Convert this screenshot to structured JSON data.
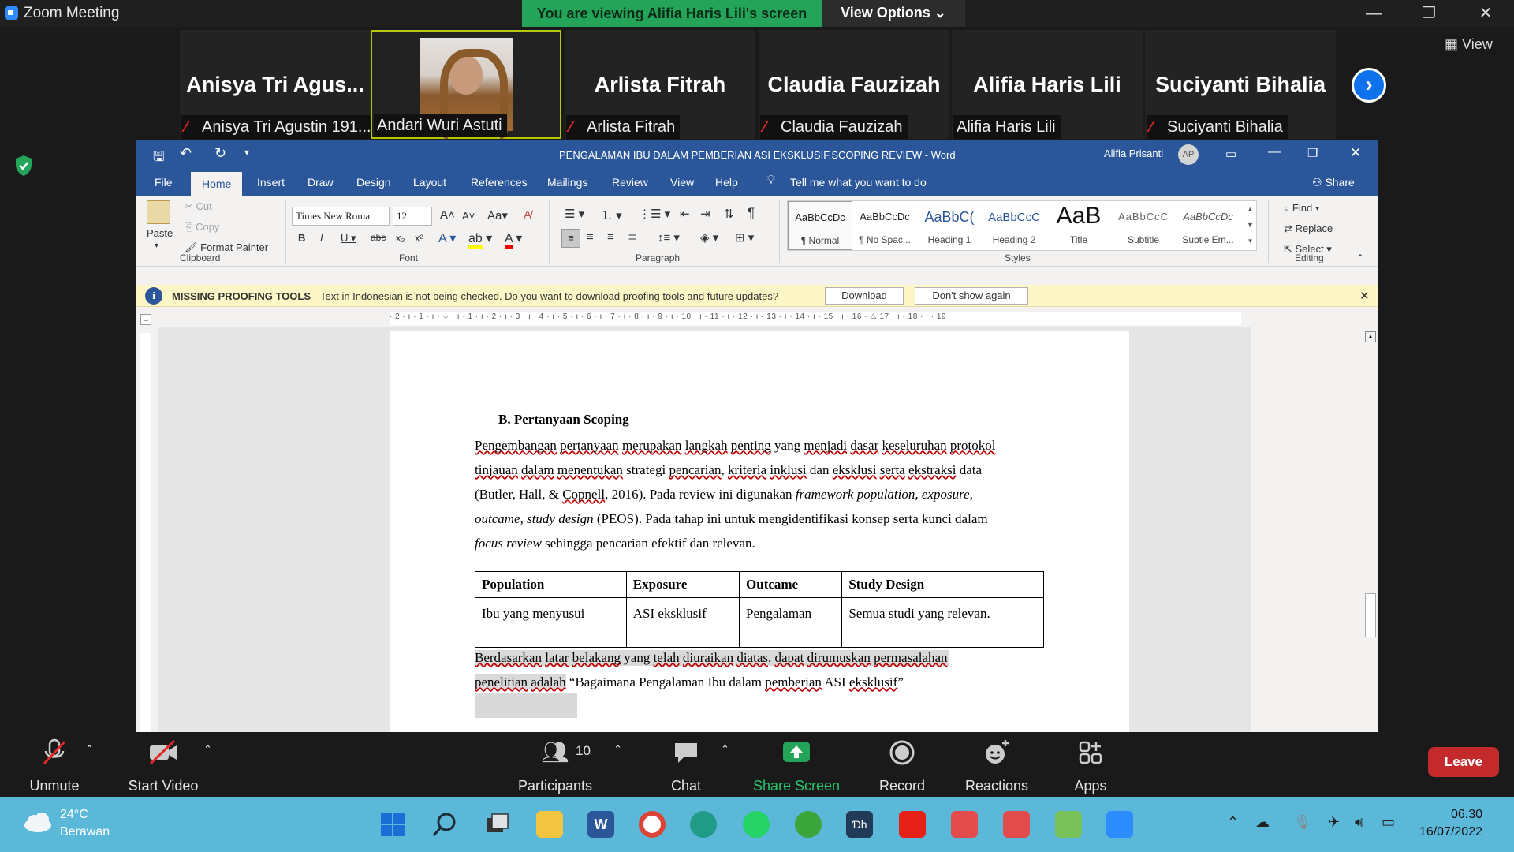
{
  "zoom": {
    "window_title": "Zoom Meeting",
    "banner": "You are viewing Alifia Haris Lili's screen",
    "view_options": "View Options ⌄",
    "view_label": "View"
  },
  "participants": [
    {
      "display_name": "Anisya Tri Agus...",
      "label": "Anisya Tri Agustin 191...",
      "muted": true
    },
    {
      "display_name": "",
      "label": "Andari Wuri Astuti",
      "muted": false
    },
    {
      "display_name": "Arlista Fitrah",
      "label": "Arlista Fitrah",
      "muted": true
    },
    {
      "display_name": "Claudia Fauzizah",
      "label": "Claudia Fauzizah",
      "muted": true
    },
    {
      "display_name": "Alifia Haris Lili",
      "label": "Alifia Haris Lili",
      "muted": false
    },
    {
      "display_name": "Suciyanti Bihalia",
      "label": "Suciyanti Bihalia",
      "muted": true
    }
  ],
  "word": {
    "doc_title": "PENGALAMAN IBU DALAM PEMBERIAN ASI EKSKLUSIF.SCOPING REVIEW  -  Word",
    "user_name": "Alifia Prisanti",
    "user_initials": "AP",
    "tabs": [
      "File",
      "Home",
      "Insert",
      "Draw",
      "Design",
      "Layout",
      "References",
      "Mailings",
      "Review",
      "View",
      "Help"
    ],
    "tell_me": "Tell me what you want to do",
    "share": "Share",
    "clipboard": {
      "paste": "Paste",
      "cut": "Cut",
      "copy": "Copy",
      "format_painter": "Format Painter",
      "label": "Clipboard"
    },
    "font": {
      "name": "Times New Roma",
      "size": "12",
      "label": "Font"
    },
    "paragraph_label": "Paragraph",
    "styles": [
      {
        "preview": "AaBbCcDc",
        "name": "¶ Normal"
      },
      {
        "preview": "AaBbCcDc",
        "name": "¶ No Spac..."
      },
      {
        "preview": "AaBbC(",
        "name": "Heading 1"
      },
      {
        "preview": "AaBbCcC",
        "name": "Heading 2"
      },
      {
        "preview": "AaB",
        "name": "Title"
      },
      {
        "preview": "AaBbCcC",
        "name": "Subtitle"
      },
      {
        "preview": "AaBbCcDc",
        "name": "Subtle Em..."
      }
    ],
    "styles_label": "Styles",
    "editing": {
      "find": "Find",
      "replace": "Replace",
      "select": "Select",
      "label": "Editing"
    },
    "message_bar": {
      "title": "MISSING PROOFING TOOLS",
      "text": "Text in Indonesian is not being checked. Do you want to download proofing tools and future updates?",
      "download": "Download",
      "dont_show": "Don't show again"
    },
    "ruler_text": "· 2 · ı · 1 · ı · ⌵ · ı · 1 · ı · 2 · ı · 3 · ı · 4 · ı · 5 · ı · 6 · ı · 7 · ı · 8 · ı · 9 · ı · 10 · ı · 11 · ı · 12 · ı · 13 · ı · 14 · ı · 15 · ı · 16 · △ 17 · ı · 18 · ı · 19",
    "document": {
      "heading": "B.  Pertanyaan Scoping",
      "para_lines": [
        "Pengembangan pertanyaan merupakan langkah penting yang menjadi dasar keseluruhan protokol",
        "tinjauan dalam menentukan strategi pencarian, kriteria inklusi dan eksklusi serta ekstraksi data",
        "(Butler, Hall, & Copnell, 2016). Pada review ini digunakan framework population, exposure,",
        "outcame, study design (PEOS). Pada tahap ini untuk mengidentifikasi konsep serta kunci dalam",
        "focus review sehingga pencarian efektif dan relevan."
      ],
      "table": {
        "headers": [
          "Population",
          "Exposure",
          "Outcame",
          "Study Design"
        ],
        "row": [
          "Ibu yang menyusui",
          "ASI eksklusif",
          "Pengalaman",
          "Semua studi yang relevan."
        ]
      },
      "after_lines": [
        "Berdasarkan latar belakang yang telah diuraikan diatas, dapat dirumuskan permasalahan",
        "penelitian adalah “Bagaimana Pengalaman Ibu dalam pemberian ASI eksklusif”"
      ]
    }
  },
  "toolbar": {
    "unmute": "Unmute",
    "start_video": "Start Video",
    "participants": "Participants",
    "participant_count": "10",
    "chat": "Chat",
    "share_screen": "Share Screen",
    "record": "Record",
    "reactions": "Reactions",
    "apps": "Apps",
    "leave": "Leave"
  },
  "taskbar": {
    "weather_temp": "24°C",
    "weather_desc": "Berawan",
    "time": "06.30",
    "date": "16/07/2022"
  },
  "colors": {
    "word_blue": "#2b579a",
    "zoom_green": "#23a459",
    "leave_red": "#c4292b",
    "taskbar": "#5bb8d9"
  }
}
